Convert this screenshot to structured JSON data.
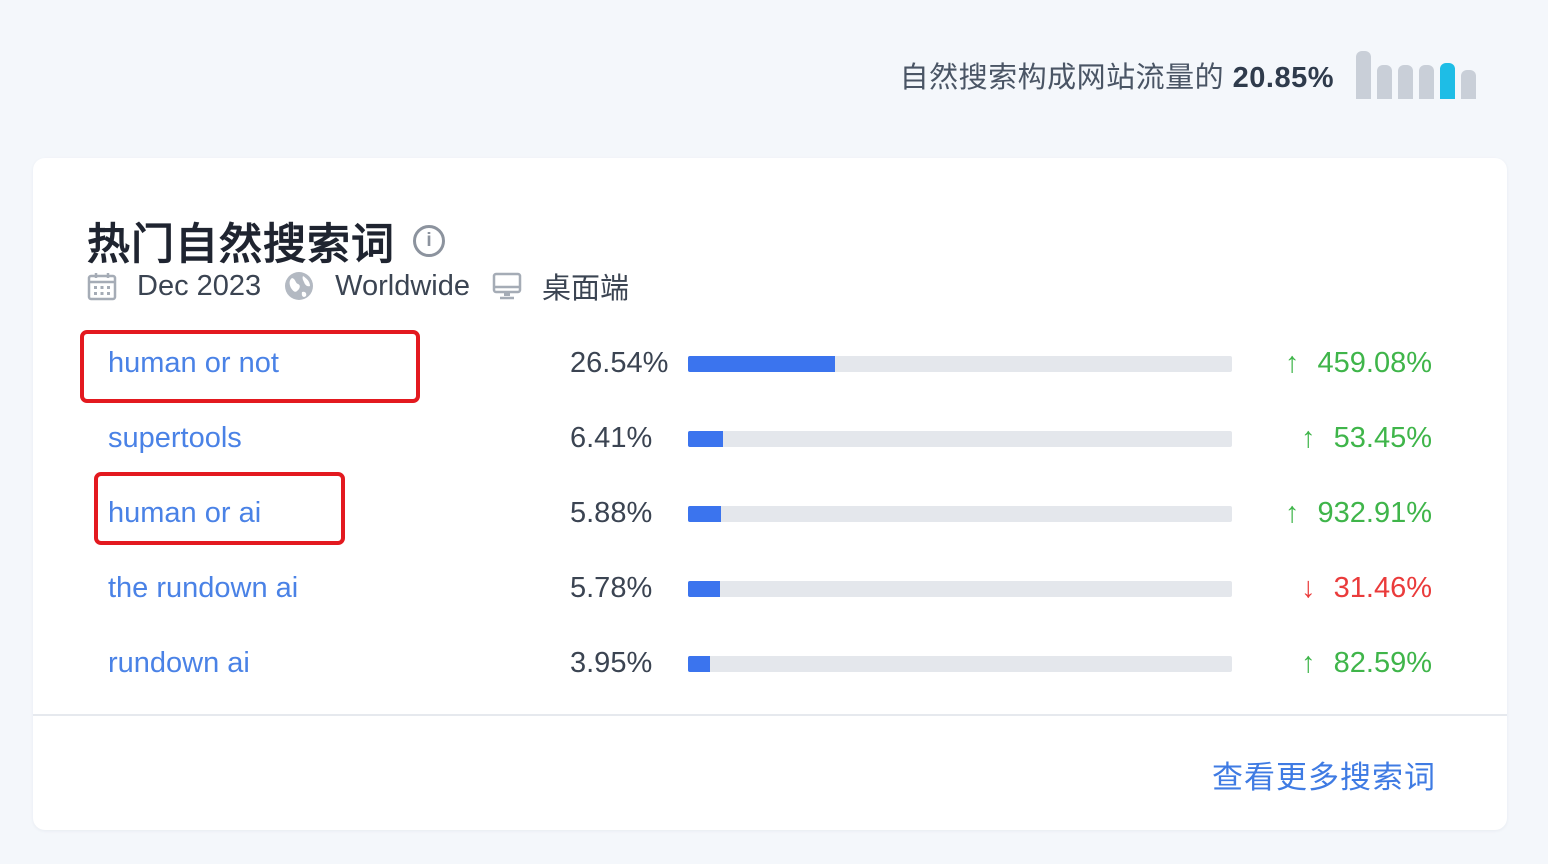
{
  "summary": {
    "prefix": "自然搜索构成网站流量的",
    "value": "20.85%",
    "mini_bar_levels": [
      1.0,
      0.7,
      0.7,
      0.7,
      0.75,
      0.6
    ]
  },
  "card": {
    "title": "热门自然搜索词",
    "meta": {
      "date": "Dec 2023",
      "region": "Worldwide",
      "device": "桌面端"
    },
    "rows": [
      {
        "keyword": "human or not",
        "share": "26.54%",
        "share_value": 26.54,
        "direction": "up",
        "arrow": "↑",
        "change": "459.08%",
        "highlighted": true
      },
      {
        "keyword": "supertools",
        "share": "6.41%",
        "share_value": 6.41,
        "direction": "up",
        "arrow": "↑",
        "change": "53.45%",
        "highlighted": false
      },
      {
        "keyword": "human or ai",
        "share": "5.88%",
        "share_value": 5.88,
        "direction": "up",
        "arrow": "↑",
        "change": "932.91%",
        "highlighted": true
      },
      {
        "keyword": "the rundown ai",
        "share": "5.78%",
        "share_value": 5.78,
        "direction": "down",
        "arrow": "↓",
        "change": "31.46%",
        "highlighted": false
      },
      {
        "keyword": "rundown ai",
        "share": "3.95%",
        "share_value": 3.95,
        "direction": "up",
        "arrow": "↑",
        "change": "82.59%",
        "highlighted": false
      }
    ],
    "more_link": "查看更多搜索词"
  },
  "colors": {
    "bar_fill": "#3b74ee",
    "up": "#3fb54a",
    "down": "#ea3b3b",
    "link": "#4a82e6",
    "highlight": "#e3191f",
    "mini_bar_active": "#1ebde6"
  },
  "icons": [
    "calendar-icon",
    "globe-icon",
    "desktop-icon",
    "info-icon",
    "arrow-up-icon",
    "arrow-down-icon"
  ]
}
